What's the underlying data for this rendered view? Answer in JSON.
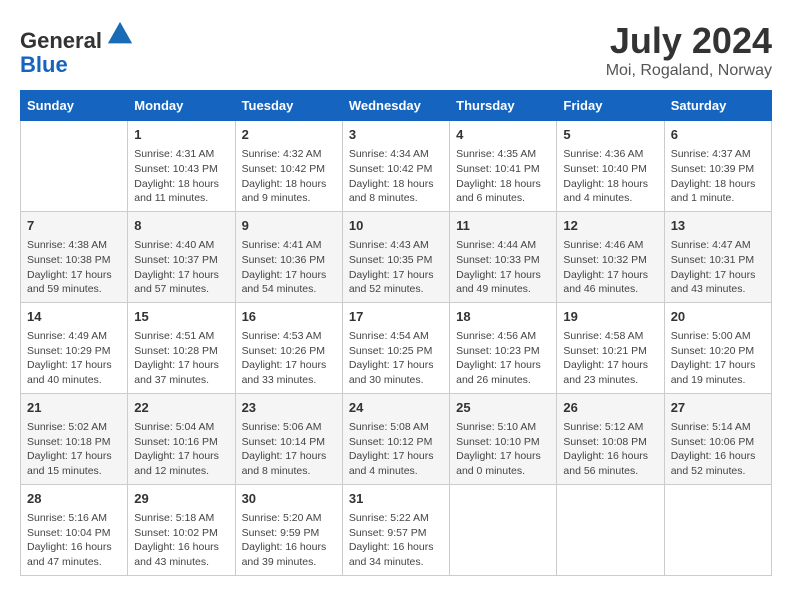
{
  "header": {
    "logo_line1": "General",
    "logo_line2": "Blue",
    "month_year": "July 2024",
    "location": "Moi, Rogaland, Norway"
  },
  "days_of_week": [
    "Sunday",
    "Monday",
    "Tuesday",
    "Wednesday",
    "Thursday",
    "Friday",
    "Saturday"
  ],
  "weeks": [
    [
      {
        "num": "",
        "info": ""
      },
      {
        "num": "1",
        "info": "Sunrise: 4:31 AM\nSunset: 10:43 PM\nDaylight: 18 hours\nand 11 minutes."
      },
      {
        "num": "2",
        "info": "Sunrise: 4:32 AM\nSunset: 10:42 PM\nDaylight: 18 hours\nand 9 minutes."
      },
      {
        "num": "3",
        "info": "Sunrise: 4:34 AM\nSunset: 10:42 PM\nDaylight: 18 hours\nand 8 minutes."
      },
      {
        "num": "4",
        "info": "Sunrise: 4:35 AM\nSunset: 10:41 PM\nDaylight: 18 hours\nand 6 minutes."
      },
      {
        "num": "5",
        "info": "Sunrise: 4:36 AM\nSunset: 10:40 PM\nDaylight: 18 hours\nand 4 minutes."
      },
      {
        "num": "6",
        "info": "Sunrise: 4:37 AM\nSunset: 10:39 PM\nDaylight: 18 hours\nand 1 minute."
      }
    ],
    [
      {
        "num": "7",
        "info": "Sunrise: 4:38 AM\nSunset: 10:38 PM\nDaylight: 17 hours\nand 59 minutes."
      },
      {
        "num": "8",
        "info": "Sunrise: 4:40 AM\nSunset: 10:37 PM\nDaylight: 17 hours\nand 57 minutes."
      },
      {
        "num": "9",
        "info": "Sunrise: 4:41 AM\nSunset: 10:36 PM\nDaylight: 17 hours\nand 54 minutes."
      },
      {
        "num": "10",
        "info": "Sunrise: 4:43 AM\nSunset: 10:35 PM\nDaylight: 17 hours\nand 52 minutes."
      },
      {
        "num": "11",
        "info": "Sunrise: 4:44 AM\nSunset: 10:33 PM\nDaylight: 17 hours\nand 49 minutes."
      },
      {
        "num": "12",
        "info": "Sunrise: 4:46 AM\nSunset: 10:32 PM\nDaylight: 17 hours\nand 46 minutes."
      },
      {
        "num": "13",
        "info": "Sunrise: 4:47 AM\nSunset: 10:31 PM\nDaylight: 17 hours\nand 43 minutes."
      }
    ],
    [
      {
        "num": "14",
        "info": "Sunrise: 4:49 AM\nSunset: 10:29 PM\nDaylight: 17 hours\nand 40 minutes."
      },
      {
        "num": "15",
        "info": "Sunrise: 4:51 AM\nSunset: 10:28 PM\nDaylight: 17 hours\nand 37 minutes."
      },
      {
        "num": "16",
        "info": "Sunrise: 4:53 AM\nSunset: 10:26 PM\nDaylight: 17 hours\nand 33 minutes."
      },
      {
        "num": "17",
        "info": "Sunrise: 4:54 AM\nSunset: 10:25 PM\nDaylight: 17 hours\nand 30 minutes."
      },
      {
        "num": "18",
        "info": "Sunrise: 4:56 AM\nSunset: 10:23 PM\nDaylight: 17 hours\nand 26 minutes."
      },
      {
        "num": "19",
        "info": "Sunrise: 4:58 AM\nSunset: 10:21 PM\nDaylight: 17 hours\nand 23 minutes."
      },
      {
        "num": "20",
        "info": "Sunrise: 5:00 AM\nSunset: 10:20 PM\nDaylight: 17 hours\nand 19 minutes."
      }
    ],
    [
      {
        "num": "21",
        "info": "Sunrise: 5:02 AM\nSunset: 10:18 PM\nDaylight: 17 hours\nand 15 minutes."
      },
      {
        "num": "22",
        "info": "Sunrise: 5:04 AM\nSunset: 10:16 PM\nDaylight: 17 hours\nand 12 minutes."
      },
      {
        "num": "23",
        "info": "Sunrise: 5:06 AM\nSunset: 10:14 PM\nDaylight: 17 hours\nand 8 minutes."
      },
      {
        "num": "24",
        "info": "Sunrise: 5:08 AM\nSunset: 10:12 PM\nDaylight: 17 hours\nand 4 minutes."
      },
      {
        "num": "25",
        "info": "Sunrise: 5:10 AM\nSunset: 10:10 PM\nDaylight: 17 hours\nand 0 minutes."
      },
      {
        "num": "26",
        "info": "Sunrise: 5:12 AM\nSunset: 10:08 PM\nDaylight: 16 hours\nand 56 minutes."
      },
      {
        "num": "27",
        "info": "Sunrise: 5:14 AM\nSunset: 10:06 PM\nDaylight: 16 hours\nand 52 minutes."
      }
    ],
    [
      {
        "num": "28",
        "info": "Sunrise: 5:16 AM\nSunset: 10:04 PM\nDaylight: 16 hours\nand 47 minutes."
      },
      {
        "num": "29",
        "info": "Sunrise: 5:18 AM\nSunset: 10:02 PM\nDaylight: 16 hours\nand 43 minutes."
      },
      {
        "num": "30",
        "info": "Sunrise: 5:20 AM\nSunset: 9:59 PM\nDaylight: 16 hours\nand 39 minutes."
      },
      {
        "num": "31",
        "info": "Sunrise: 5:22 AM\nSunset: 9:57 PM\nDaylight: 16 hours\nand 34 minutes."
      },
      {
        "num": "",
        "info": ""
      },
      {
        "num": "",
        "info": ""
      },
      {
        "num": "",
        "info": ""
      }
    ]
  ]
}
